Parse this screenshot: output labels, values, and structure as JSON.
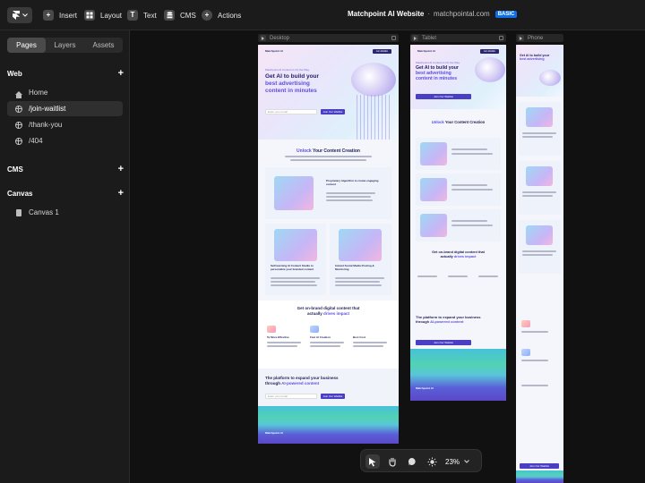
{
  "topbar": {
    "insert_label": "Insert",
    "layout_label": "Layout",
    "text_label": "Text",
    "cms_label": "CMS",
    "actions_label": "Actions",
    "site_name": "Matchpoint AI Website",
    "site_separator": "·",
    "site_url": "matchpointal.com",
    "plan_badge": "BASIC"
  },
  "sidebar": {
    "tabs": [
      "Pages",
      "Layers",
      "Assets"
    ],
    "active_tab": "Pages",
    "web_section": "Web",
    "pages": [
      {
        "label": "Home",
        "icon": "home-icon"
      },
      {
        "label": "/join-waitlist",
        "icon": "globe-icon",
        "active": true
      },
      {
        "label": "/thank-you",
        "icon": "globe-icon"
      },
      {
        "label": "/404",
        "icon": "globe-icon"
      }
    ],
    "cms_section": "CMS",
    "canvas_section": "Canvas",
    "canvas_items": [
      {
        "label": "Canvas 1",
        "icon": "document-icon"
      }
    ]
  },
  "breakpoints": {
    "desktop_label": "Desktop",
    "tablet_label": "Tablet",
    "phone_label": "Phone"
  },
  "site": {
    "brand": "Matchpoint AI",
    "nav_cta": "Join Waitlist",
    "hero_kicker": "Matchpoint AI Content is On the Way",
    "hero_line1": "Get AI to build your",
    "hero_line2": "best advertising",
    "hero_line3": "content in minutes",
    "email_placeholder": "Enter your email",
    "join_button": "Join Our Waitlist",
    "unlock_highlight": "Unlock",
    "unlock_rest": "Your Content Creation",
    "card1_title": "Proprietary Algorithm to create engaging content",
    "card2_title": "Self-learning AI Content Studio to personalize your branded content",
    "card3_title": "Instant Social Media Posting & Monitoring",
    "onbrand_line1": "Get on-brand digital content that",
    "onbrand_line2a": "actually",
    "onbrand_line2b": "drives impact",
    "feature1_title": "5x More Effective",
    "feature2_title": "Fast AI Creation",
    "feature3_title": "Best Cost",
    "platform_line1": "The platform to expand your business",
    "platform_line2a": "through",
    "platform_line2b": "AI-powered content",
    "footer_brand": "Matchpoint AI"
  },
  "bottombar": {
    "zoom_level": "23%",
    "tools": [
      "cursor-icon",
      "hand-icon",
      "comment-icon",
      "sun-icon"
    ]
  },
  "colors": {
    "accent": "#5b4fe1",
    "badge": "#0f6fe6",
    "ui_bg": "#1b1b1b",
    "canvas_bg": "#111111"
  }
}
